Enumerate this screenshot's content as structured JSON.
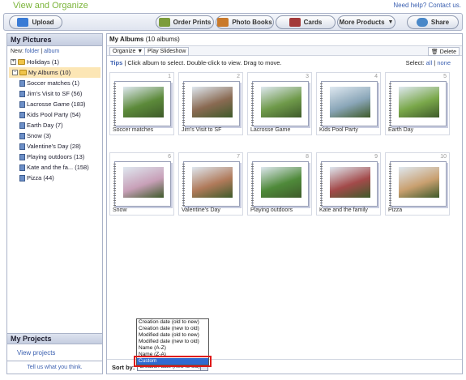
{
  "app": {
    "title": "View and Organize",
    "help": "Need help?",
    "contact": "Contact us."
  },
  "toolbar": {
    "upload": "Upload",
    "order_prints": "Order Prints",
    "photo_books": "Photo Books",
    "cards": "Cards",
    "more_products": "More Products",
    "share": "Share"
  },
  "sidebar": {
    "title": "My Pictures",
    "new_label": "New:",
    "new_folder": "folder",
    "new_album": "album",
    "folders": [
      {
        "label": "Holidays (1)"
      },
      {
        "label": "My Albums (10)"
      }
    ],
    "albums": [
      "Soccer matches (1)",
      "Jim's Visit to SF (56)",
      "Lacrosse Game (183)",
      "Kids Pool Party (54)",
      "Earth Day (7)",
      "Snow (3)",
      "Valentine's Day (28)",
      "Playing outdoors (13)",
      "Kate and the fa... (158)",
      "Pizza (44)"
    ],
    "projects_title": "My Projects",
    "view_projects": "View projects",
    "tell_us": "Tell us what you think."
  },
  "main": {
    "title": "My Albums",
    "count": "(10 albums)",
    "organize": "Organize ▼",
    "slideshow": "Play Slideshow",
    "delete": "Delete",
    "tips": "Tips",
    "tips_text": "| Click album to select. Double-click to view. Drag to move.",
    "select_label": "Select:",
    "select_all": "all",
    "select_none": "none",
    "albums": [
      {
        "num": "1",
        "label": "Soccer matches",
        "color": "#5c8a3a"
      },
      {
        "num": "2",
        "label": "Jim's Visit to SF",
        "color": "#8a6a52"
      },
      {
        "num": "3",
        "label": "Lacrosse Game",
        "color": "#6f9a4a"
      },
      {
        "num": "4",
        "label": "Kids Pool Party",
        "color": "#8aa6b8"
      },
      {
        "num": "5",
        "label": "Earth Day",
        "color": "#7aa84a"
      },
      {
        "num": "6",
        "label": "Snow",
        "color": "#c8a0b8"
      },
      {
        "num": "7",
        "label": "Valentine's Day",
        "color": "#b07a5a"
      },
      {
        "num": "8",
        "label": "Playing outdoors",
        "color": "#4f8a3a"
      },
      {
        "num": "9",
        "label": "Kate and the family",
        "color": "#a34a4a"
      },
      {
        "num": "10",
        "label": "Pizza",
        "color": "#c9a070"
      }
    ]
  },
  "sort": {
    "label": "Sort by:",
    "selected": "Creation date (new to old)",
    "options": [
      "Creation date (old to new)",
      "Creation date (new to old)",
      "Modified date (old to new)",
      "Modified date (new to old)",
      "Name (A-Z)",
      "Name (Z-A)",
      "Custom"
    ],
    "highlighted": "Custom"
  }
}
